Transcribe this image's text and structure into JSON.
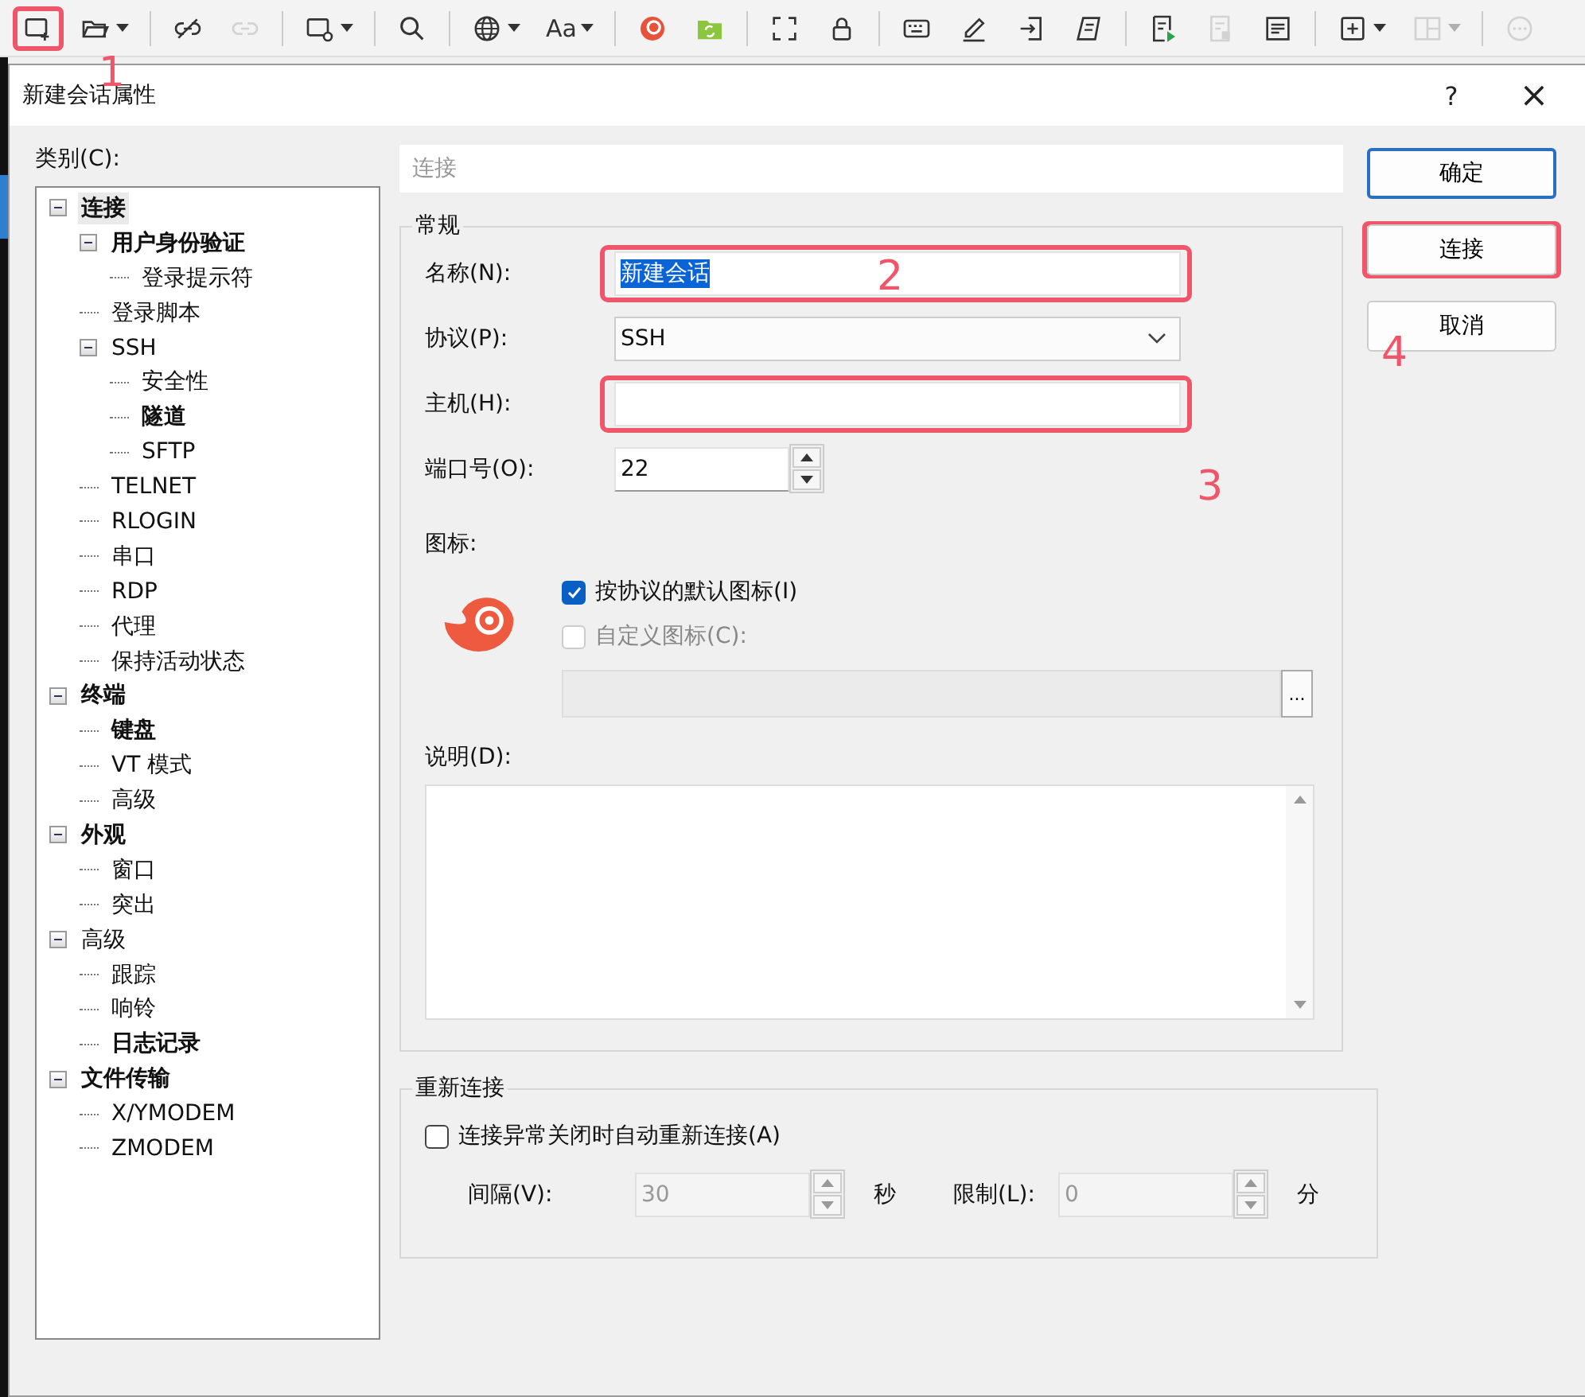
{
  "toolbar": {
    "groups": [
      [
        {
          "dropdown": false,
          "disabled": false,
          "highlighted": true
        },
        {
          "dropdown": true,
          "disabled": false,
          "highlighted": false
        }
      ],
      [
        {
          "dropdown": false,
          "disabled": false,
          "highlighted": false
        },
        {
          "dropdown": false,
          "disabled": true,
          "highlighted": false
        }
      ],
      [
        {
          "dropdown": true,
          "disabled": false,
          "highlighted": false
        }
      ],
      [
        {
          "dropdown": false,
          "disabled": false,
          "highlighted": false
        }
      ],
      [
        {
          "dropdown": true,
          "disabled": false,
          "highlighted": false
        },
        {
          "label": "Aa",
          "dropdown": true,
          "disabled": false,
          "highlighted": false
        }
      ],
      [
        {
          "dropdown": false,
          "disabled": false,
          "highlighted": false
        },
        {
          "dropdown": false,
          "disabled": false,
          "highlighted": false
        }
      ],
      [
        {
          "dropdown": false,
          "disabled": false,
          "highlighted": false
        },
        {
          "dropdown": false,
          "disabled": false,
          "highlighted": false
        }
      ],
      [
        {
          "dropdown": false,
          "disabled": false,
          "highlighted": false
        },
        {
          "dropdown": false,
          "disabled": false,
          "highlighted": false
        },
        {
          "dropdown": false,
          "disabled": false,
          "highlighted": false
        },
        {
          "dropdown": false,
          "disabled": false,
          "highlighted": false
        }
      ],
      [
        {
          "dropdown": false,
          "disabled": false,
          "highlighted": false
        },
        {
          "dropdown": false,
          "disabled": true,
          "highlighted": false
        },
        {
          "dropdown": false,
          "disabled": false,
          "highlighted": false
        }
      ],
      [
        {
          "dropdown": true,
          "disabled": false,
          "highlighted": false
        },
        {
          "dropdown": true,
          "disabled": true,
          "highlighted": false
        }
      ],
      [
        {
          "dropdown": false,
          "disabled": true,
          "highlighted": false
        }
      ]
    ]
  },
  "dialog": {
    "title": "新建会话属性",
    "help_button": "?",
    "close_button": "×",
    "category_label": "类别(C):",
    "tree": [
      {
        "label": "连接",
        "bold": true,
        "selected": true,
        "expanded": true,
        "children": [
          {
            "label": "用户身份验证",
            "bold": true,
            "selected": false,
            "expanded": true,
            "children": [
              {
                "label": "登录提示符",
                "bold": false,
                "selected": false
              }
            ]
          },
          {
            "label": "登录脚本",
            "bold": false,
            "selected": false
          },
          {
            "label": "SSH",
            "bold": false,
            "selected": false,
            "expanded": true,
            "children": [
              {
                "label": "安全性",
                "bold": false,
                "selected": false
              },
              {
                "label": "隧道",
                "bold": true,
                "selected": false
              },
              {
                "label": "SFTP",
                "bold": false,
                "selected": false
              }
            ]
          },
          {
            "label": "TELNET",
            "bold": false,
            "selected": false
          },
          {
            "label": "RLOGIN",
            "bold": false,
            "selected": false
          },
          {
            "label": "串口",
            "bold": false,
            "selected": false
          },
          {
            "label": "RDP",
            "bold": false,
            "selected": false
          },
          {
            "label": "代理",
            "bold": false,
            "selected": false
          },
          {
            "label": "保持活动状态",
            "bold": false,
            "selected": false
          }
        ]
      },
      {
        "label": "终端",
        "bold": true,
        "selected": false,
        "expanded": true,
        "children": [
          {
            "label": "键盘",
            "bold": true,
            "selected": false
          },
          {
            "label": "VT 模式",
            "bold": false,
            "selected": false
          },
          {
            "label": "高级",
            "bold": false,
            "selected": false
          }
        ]
      },
      {
        "label": "外观",
        "bold": true,
        "selected": false,
        "expanded": true,
        "children": [
          {
            "label": "窗口",
            "bold": false,
            "selected": false
          },
          {
            "label": "突出",
            "bold": false,
            "selected": false
          }
        ]
      },
      {
        "label": "高级",
        "bold": false,
        "selected": false,
        "expanded": true,
        "children": [
          {
            "label": "跟踪",
            "bold": false,
            "selected": false
          },
          {
            "label": "响铃",
            "bold": false,
            "selected": false
          },
          {
            "label": "日志记录",
            "bold": true,
            "selected": false
          }
        ]
      },
      {
        "label": "文件传输",
        "bold": true,
        "selected": false,
        "expanded": true,
        "children": [
          {
            "label": "X/YMODEM",
            "bold": false,
            "selected": false
          },
          {
            "label": "ZMODEM",
            "bold": false,
            "selected": false
          }
        ]
      }
    ],
    "header": "连接",
    "general": {
      "legend": "常规",
      "fields": [
        {
          "kind": "text",
          "label": "名称(N):",
          "value": "新建会话",
          "text_selected": true,
          "highlighted": true
        },
        {
          "kind": "select",
          "label": "协议(P):",
          "value": "SSH",
          "highlighted": false
        },
        {
          "kind": "text",
          "label": "主机(H):",
          "highlighted": true
        },
        {
          "kind": "spin",
          "label": "端口号(O):",
          "value": "22",
          "highlighted": false
        }
      ],
      "icon_label": "图标:",
      "default_icon": {
        "label": "按协议的默认图标(I)",
        "checked": true,
        "disabled": false
      },
      "custom_icon": {
        "label": "自定义图标(C):",
        "checked": false,
        "disabled": true
      },
      "browse_button": "...",
      "description_label": "说明(D):"
    },
    "reconnect": {
      "legend": "重新连接",
      "auto": {
        "label": "连接异常关闭时自动重新连接(A)",
        "checked": false,
        "disabled": false
      },
      "interval": {
        "label": "间隔(V):",
        "value": "30",
        "unit": "秒",
        "disabled": true
      },
      "limit": {
        "label": "限制(L):",
        "value": "0",
        "unit": "分",
        "disabled": true
      }
    },
    "buttons": [
      {
        "label": "确定",
        "default": true,
        "highlighted": false
      },
      {
        "label": "连接",
        "default": false,
        "highlighted": true
      },
      {
        "label": "取消",
        "default": false,
        "highlighted": false
      }
    ]
  },
  "annotations": [
    "1",
    "2",
    "3",
    "4"
  ]
}
